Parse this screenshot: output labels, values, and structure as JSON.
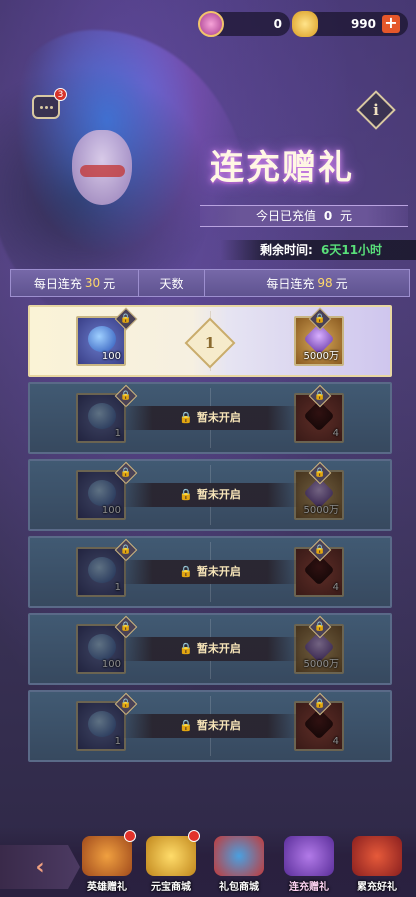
{
  "currency": {
    "jade_icon": "jade-coin-icon",
    "jade_value": "0",
    "ingot_icon": "gold-ingot-icon",
    "ingot_value": "990",
    "plus_label": "+"
  },
  "chat": {
    "badge": "3"
  },
  "info_label": "i",
  "title": "连充赠礼",
  "recharged": {
    "label": "今日已充值",
    "amount": "0",
    "unit": "元"
  },
  "time_left": {
    "label": "剩余时间:",
    "value": "6天11小时"
  },
  "header": {
    "col1_prefix": "每日连充",
    "col1_amount": "30",
    "col1_unit": "元",
    "col2": "天数",
    "col3_prefix": "每日连充",
    "col3_amount": "98",
    "col3_unit": "元"
  },
  "rows": [
    {
      "day": "1",
      "state": "active",
      "left_qty": "100",
      "right_qty": "5000万",
      "right_style": "purple"
    },
    {
      "state": "locked",
      "locked_text": "暂未开启",
      "left_qty": "1",
      "right_qty": "4",
      "right_style": "red"
    },
    {
      "state": "locked",
      "locked_text": "暂未开启",
      "left_qty": "100",
      "right_qty": "5000万",
      "right_style": "purple"
    },
    {
      "state": "locked",
      "locked_text": "暂未开启",
      "left_qty": "1",
      "right_qty": "4",
      "right_style": "red"
    },
    {
      "state": "locked",
      "locked_text": "暂未开启",
      "left_qty": "100",
      "right_qty": "5000万",
      "right_style": "purple"
    },
    {
      "state": "locked",
      "locked_text": "暂未开启",
      "left_qty": "1",
      "right_qty": "4",
      "right_style": "red"
    }
  ],
  "nav": [
    {
      "label": "英雄赠礼",
      "icon": "hero-gift-icon",
      "dot": true
    },
    {
      "label": "元宝商城",
      "icon": "ingot-shop-icon",
      "dot": true
    },
    {
      "label": "礼包商城",
      "icon": "gift-pack-shop-icon",
      "dot": false
    },
    {
      "label": "连充赠礼",
      "icon": "consecutive-recharge-icon",
      "dot": false,
      "active": true
    },
    {
      "label": "累充好礼",
      "icon": "cumulative-recharge-icon",
      "dot": false
    }
  ]
}
